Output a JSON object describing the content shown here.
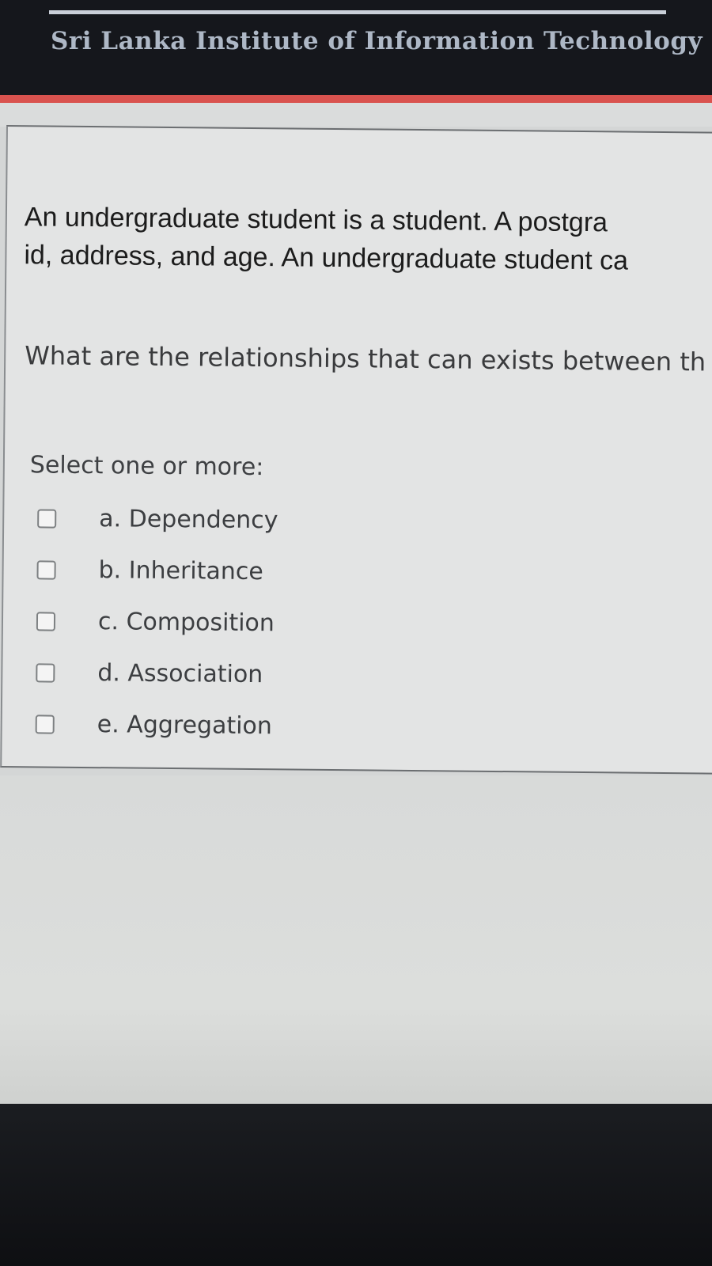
{
  "header": {
    "institution": "Sri Lanka Institute of Information Technology"
  },
  "question": {
    "line1": "An undergraduate student is a student.   A postgra",
    "line2": "id, address, and age. An undergraduate student ca",
    "prompt": "What are the relationships that can exists between th"
  },
  "answer": {
    "instruction": "Select one or more:",
    "options": [
      {
        "label": "a. Dependency",
        "checked": false
      },
      {
        "label": "b. Inheritance",
        "checked": false
      },
      {
        "label": "c. Composition",
        "checked": false
      },
      {
        "label": "d. Association",
        "checked": false
      },
      {
        "label": "e. Aggregation",
        "checked": false
      }
    ]
  },
  "colors": {
    "header_bg": "#15171c",
    "accent": "#d9534f",
    "card_bg": "#e3e4e4"
  }
}
